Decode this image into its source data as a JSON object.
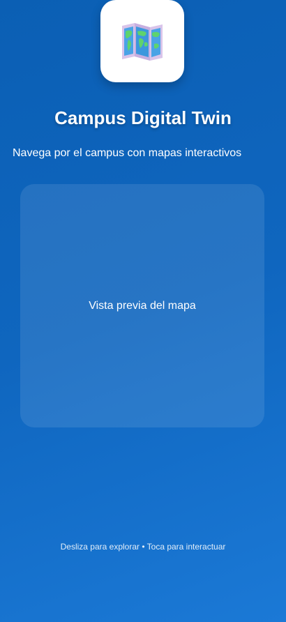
{
  "app": {
    "icon": "world-map-icon",
    "title": "Campus Digital Twin",
    "subtitle": "Navega por el campus con mapas interactivos"
  },
  "map_preview": {
    "label": "Vista previa del mapa"
  },
  "hint": {
    "text": "Desliza para explorar • Toca para interactuar"
  },
  "colors": {
    "background_top": "#0b5fb4",
    "background_bottom": "#1b79d6",
    "text": "#ffffff"
  }
}
